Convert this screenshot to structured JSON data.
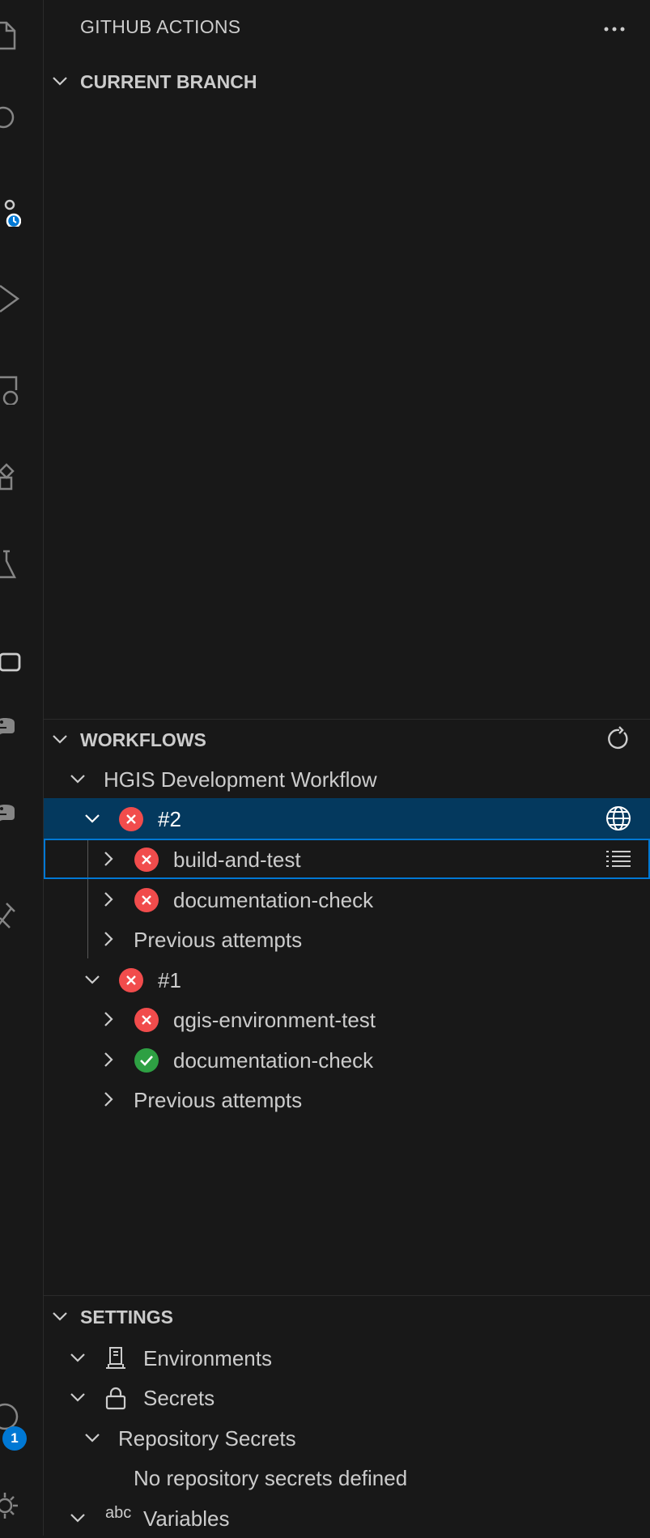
{
  "sidebar": {
    "title": "GITHUB ACTIONS",
    "more_icon": "ellipsis-icon"
  },
  "activity_bar": {
    "icons": [
      "explorer-icon",
      "search-icon",
      "github-actions-icon",
      "run-debug-icon",
      "remote-explorer-icon",
      "extensions-icon",
      "testing-icon",
      "terminal-icon",
      "python-icon",
      "python-env-icon",
      "tools-icon",
      "accounts-icon",
      "manage-gear-icon"
    ],
    "accounts_badge": "1"
  },
  "sections": {
    "current_branch": {
      "label": "CURRENT BRANCH"
    },
    "workflows": {
      "label": "WORKFLOWS",
      "refresh_icon": "refresh-icon",
      "workflow_name": "HGIS Development Workflow",
      "runs": [
        {
          "label": "#2",
          "status": "failed",
          "open_icon": "globe-icon",
          "jobs": [
            {
              "label": "build-and-test",
              "status": "failed",
              "action_icon": "list-icon"
            },
            {
              "label": "documentation-check",
              "status": "failed"
            }
          ],
          "previous": "Previous attempts"
        },
        {
          "label": "#1",
          "status": "failed",
          "jobs": [
            {
              "label": "qgis-environment-test",
              "status": "failed"
            },
            {
              "label": "documentation-check",
              "status": "success"
            }
          ],
          "previous": "Previous attempts"
        }
      ]
    },
    "settings": {
      "label": "SETTINGS",
      "items": {
        "environments": "Environments",
        "secrets": "Secrets",
        "repository_secrets": "Repository Secrets",
        "no_secrets": "No repository secrets defined",
        "variables_icon_text": "abc",
        "variables": "Variables"
      }
    }
  },
  "colors": {
    "failed": "#f14c4c",
    "success": "#2ea043",
    "selection": "#04395e",
    "focus": "#0078d4"
  }
}
